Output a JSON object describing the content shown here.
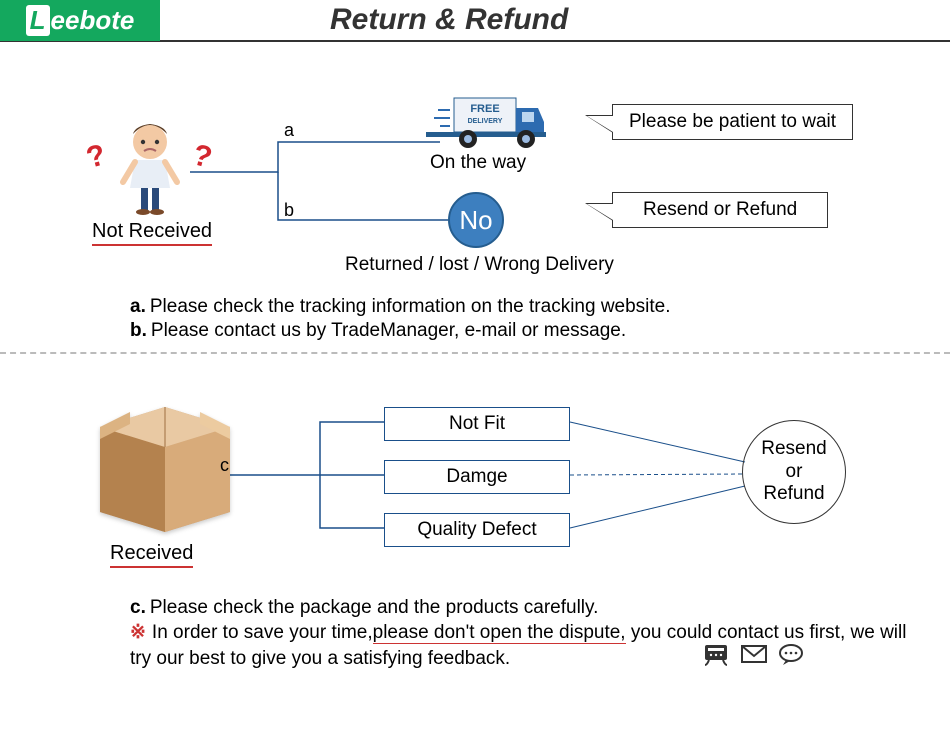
{
  "brand": "Leebote",
  "title": "Return & Refund",
  "section1": {
    "status": "Not Received",
    "branch_a": {
      "key": "a",
      "label": "On the way",
      "speech": "Please be patient to wait",
      "truck_text": "FREE DELIVERY"
    },
    "branch_b": {
      "key": "b",
      "circle": "No",
      "label": "Returned / lost / Wrong Delivery",
      "speech": "Resend or Refund"
    },
    "notes": {
      "a": {
        "key": "a.",
        "text": "Please check the tracking information on the tracking website."
      },
      "b": {
        "key": "b.",
        "text": "Please contact us by TradeManager, e-mail or message."
      }
    }
  },
  "section2": {
    "status": "Received",
    "branch_c_key": "c",
    "options": [
      "Not Fit",
      "Damge",
      "Quality Defect"
    ],
    "outcome": "Resend\nor\nRefund",
    "notes": {
      "c": {
        "key": "c.",
        "text": "Please check the package and the products carefully."
      },
      "warn": {
        "prefix": "In order to save your time,",
        "underline": "please don't open the dispute,",
        "suffix": " you could  contact us first, we will try our best to give you a satisfying feedback."
      }
    }
  },
  "icons": [
    "phone-icon",
    "mail-icon",
    "chat-icon"
  ]
}
